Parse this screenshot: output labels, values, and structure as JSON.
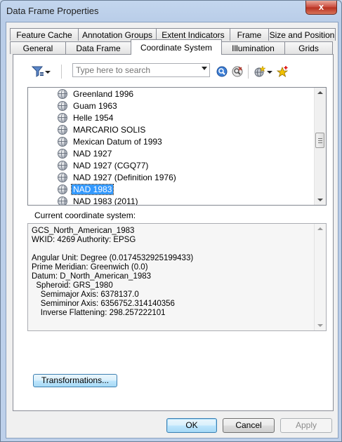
{
  "window": {
    "title": "Data Frame Properties",
    "close_glyph": "x"
  },
  "tabs_back": [
    {
      "label": "Feature Cache"
    },
    {
      "label": "Annotation Groups"
    },
    {
      "label": "Extent Indicators"
    },
    {
      "label": "Frame"
    },
    {
      "label": "Size and Position"
    }
  ],
  "tabs_front": [
    {
      "label": "General"
    },
    {
      "label": "Data Frame"
    },
    {
      "label": "Coordinate System",
      "active": true
    },
    {
      "label": "Illumination"
    },
    {
      "label": "Grids"
    }
  ],
  "toolbar": {
    "filter_icon": "filter-icon",
    "search_placeholder": "Type here to search",
    "search_icon": "search-icon",
    "clear_search_icon": "clear-search-icon",
    "add_globe_icon": "globe-add-icon",
    "favorite_icon": "star-add-icon"
  },
  "tree": {
    "items": [
      {
        "label": "Greenland 1996"
      },
      {
        "label": "Guam 1963"
      },
      {
        "label": "Helle 1954"
      },
      {
        "label": "MARCARIO SOLIS"
      },
      {
        "label": "Mexican Datum of 1993"
      },
      {
        "label": "NAD 1927"
      },
      {
        "label": "NAD 1927 (CGQ77)"
      },
      {
        "label": "NAD 1927 (Definition 1976)"
      },
      {
        "label": "NAD 1983",
        "selected": true
      },
      {
        "label": "NAD 1983 (2011)"
      }
    ]
  },
  "current": {
    "label": "Current coordinate system:",
    "lines": [
      "GCS_North_American_1983",
      "WKID: 4269 Authority: EPSG",
      "",
      "Angular Unit: Degree (0.0174532925199433)",
      "Prime Meridian: Greenwich (0.0)",
      "Datum: D_North_American_1983",
      "  Spheroid: GRS_1980",
      "    Semimajor Axis: 6378137.0",
      "    Semiminor Axis: 6356752.314140356",
      "    Inverse Flattening: 298.257222101"
    ]
  },
  "buttons": {
    "transformations": "Transformations...",
    "ok": "OK",
    "cancel": "Cancel",
    "apply": "Apply"
  }
}
